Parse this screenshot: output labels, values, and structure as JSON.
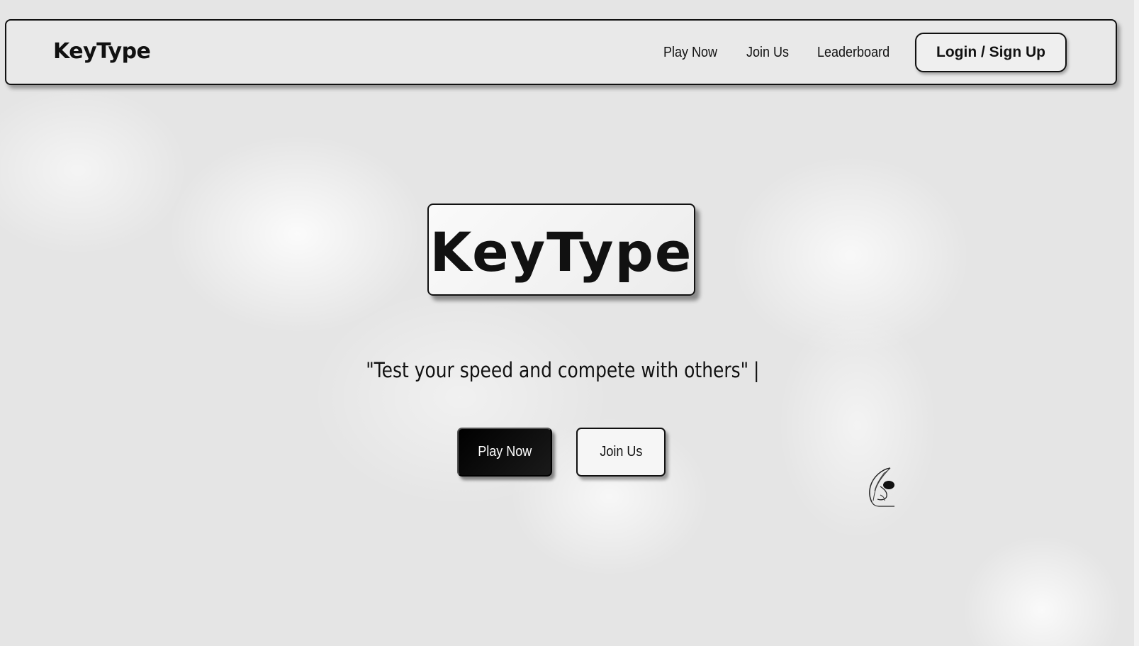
{
  "header": {
    "brand": "KeyType",
    "nav": [
      {
        "label": "Play Now"
      },
      {
        "label": "Join Us"
      },
      {
        "label": "Leaderboard"
      }
    ],
    "login_label": "Login / Sign Up"
  },
  "hero": {
    "logo_text": "KeyType",
    "tagline": "\"Test your speed and compete with others\"",
    "typing_cursor": "|",
    "primary_cta": "Play Now",
    "secondary_cta": "Join Us"
  },
  "decorations": {
    "quill_icon": "quill-pen-icon"
  },
  "colors": {
    "background": "#e6e6e6",
    "primary_button": "#000000",
    "text": "#111111"
  }
}
